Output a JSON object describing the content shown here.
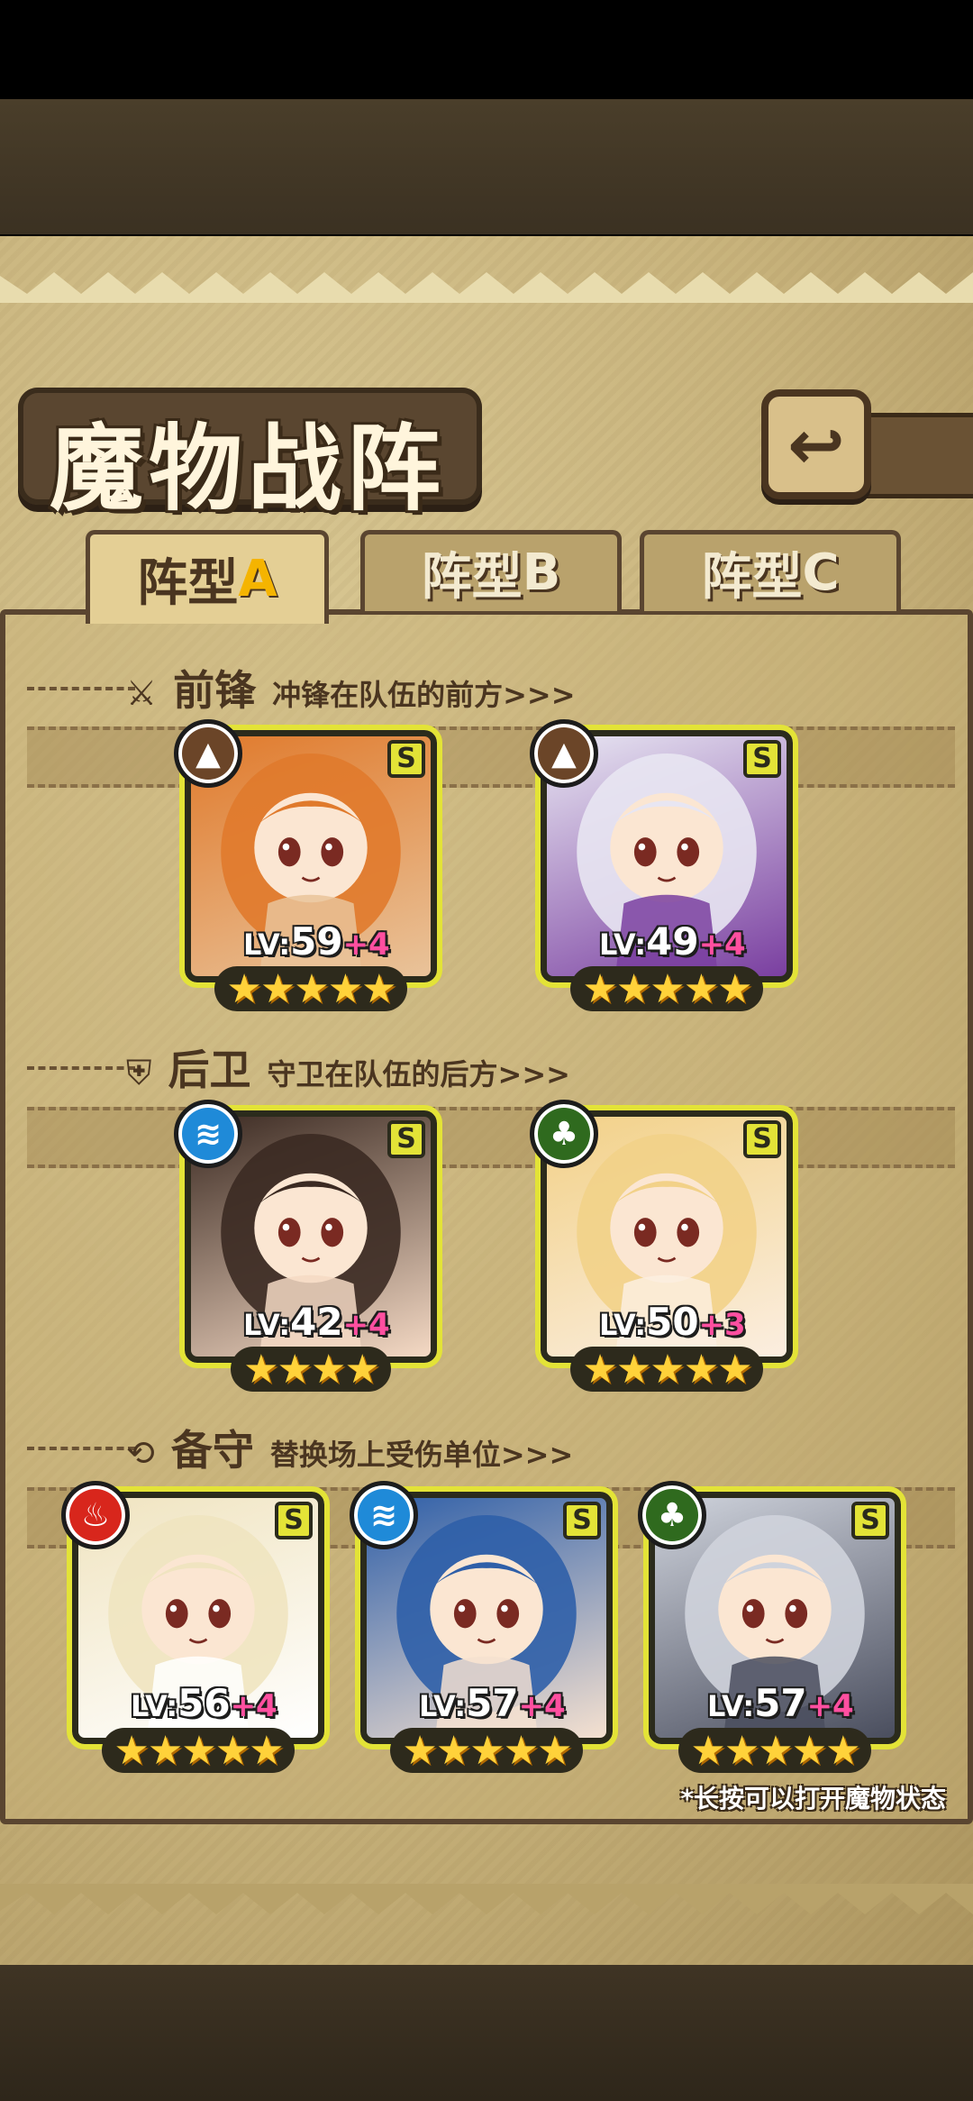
{
  "title": "魔物战阵",
  "back_label": "↩",
  "tabs": [
    {
      "prefix": "阵型",
      "suffix": "A",
      "active": true
    },
    {
      "prefix": "阵型",
      "suffix": "B",
      "active": false
    },
    {
      "prefix": "阵型",
      "suffix": "C",
      "active": false
    }
  ],
  "sections": {
    "front": {
      "icon": "sword-icon",
      "title": "前锋",
      "subtitle": "冲锋在队伍的前方>>>"
    },
    "rear": {
      "icon": "shield-icon",
      "title": "后卫",
      "subtitle": "守卫在队伍的后方>>>"
    },
    "reserve": {
      "icon": "swap-icon",
      "title": "备守",
      "subtitle": "替换场上受伤单位>>>"
    }
  },
  "cards": [
    {
      "element": "earth",
      "element_icon": "earth-icon",
      "rank": "S",
      "lv_label": "LV:",
      "level": "59",
      "plus": "+4",
      "stars": 5,
      "palette": [
        "#e07a2c",
        "#e9c39a"
      ]
    },
    {
      "element": "earth",
      "element_icon": "earth-icon",
      "rank": "S",
      "lv_label": "LV:",
      "level": "49",
      "plus": "+4",
      "stars": 5,
      "palette": [
        "#e8e6f2",
        "#7a3fa0"
      ]
    },
    {
      "element": "water",
      "element_icon": "water-icon",
      "rank": "S",
      "lv_label": "LV:",
      "level": "42",
      "plus": "+4",
      "stars": 4,
      "palette": [
        "#3b2a22",
        "#f4d9c4"
      ]
    },
    {
      "element": "nature",
      "element_icon": "leaf-icon",
      "rank": "S",
      "lv_label": "LV:",
      "level": "50",
      "plus": "+3",
      "stars": 5,
      "palette": [
        "#f2d188",
        "#fbeee0"
      ]
    },
    {
      "element": "fire",
      "element_icon": "fire-icon",
      "rank": "S",
      "lv_label": "LV:",
      "level": "56",
      "plus": "+4",
      "stars": 5,
      "palette": [
        "#f0e4c0",
        "#ffffff"
      ]
    },
    {
      "element": "water",
      "element_icon": "water-icon",
      "rank": "S",
      "lv_label": "LV:",
      "level": "57",
      "plus": "+4",
      "stars": 5,
      "palette": [
        "#2f5fa8",
        "#f5e1d0"
      ]
    },
    {
      "element": "nature",
      "element_icon": "leaf-icon",
      "rank": "S",
      "lv_label": "LV:",
      "level": "57",
      "plus": "+4",
      "stars": 5,
      "palette": [
        "#cfd3dc",
        "#4a4e5e"
      ]
    }
  ],
  "element_colors": {
    "earth": "#6b4528",
    "water": "#1f8ad8",
    "nature": "#2f6a1e",
    "fire": "#d8261c"
  },
  "element_glyphs": {
    "earth": "▲",
    "water": "≋",
    "nature": "♣",
    "fire": "♨"
  },
  "hint": "*长按可以打开魔物状态",
  "accent_colors": {
    "card_border": "#e3e337",
    "star": "#ffd23a",
    "plus_text": "#ff4fa0"
  }
}
